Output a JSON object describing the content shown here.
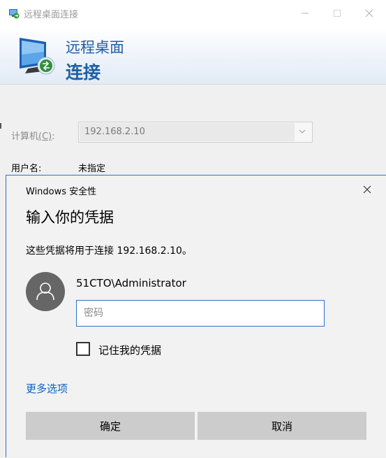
{
  "rd_window": {
    "title": "远程桌面连接",
    "banner_line1": "远程桌面",
    "banner_line2": "连接",
    "computer_label": "计算机",
    "computer_label_accel": "(C)",
    "computer_label_colon": ":",
    "computer_value": "192.168.2.10",
    "user_label": "用户名:",
    "user_value": "未指定"
  },
  "security_dialog": {
    "title": "Windows 安全性",
    "heading": "输入你的凭据",
    "message": "这些凭据将用于连接 192.168.2.10。",
    "username": "51CTO\\Administrator",
    "password_placeholder": "密码",
    "password_value": "",
    "remember_label": "记住我的凭据",
    "remember_checked": false,
    "more_options": "更多选项",
    "ok_label": "确定",
    "cancel_label": "取消"
  },
  "colors": {
    "accent": "#1f5fa6",
    "focus_border": "#2e6fd0",
    "link": "#0a62c9",
    "button_bg": "#cccccc",
    "avatar_bg": "#666666"
  },
  "icons": {
    "window_icon": "remote-desktop-icon",
    "banner_logo": "remote-desktop-monitor-icon",
    "avatar": "user-icon",
    "close": "close-icon",
    "combo_arrow": "chevron-down-icon"
  }
}
